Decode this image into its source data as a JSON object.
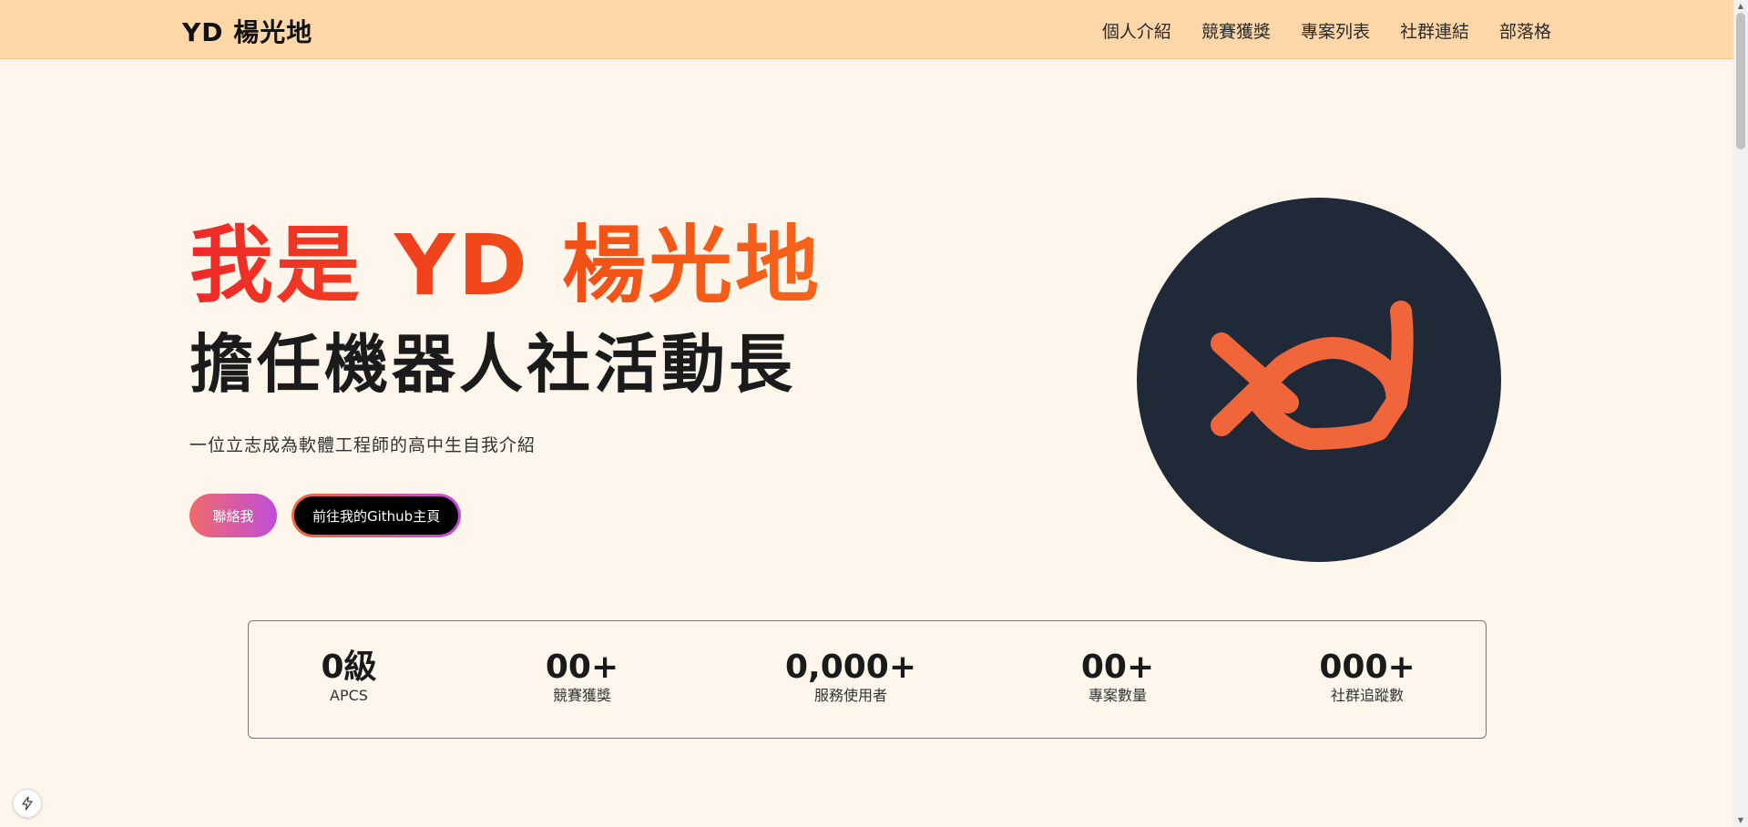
{
  "navbar": {
    "brand": "YD 楊光地",
    "links": [
      "個人介紹",
      "競賽獲獎",
      "專案列表",
      "社群連結",
      "部落格"
    ],
    "background_color": "#fed7a8"
  },
  "hero": {
    "title": "我是 YD 楊光地",
    "subtitle": "擔任機器人社活動長",
    "description": "一位立志成為軟體工程師的高中生自我介紹",
    "contact_button": "聯絡我",
    "github_button": "前往我的Github主頁",
    "logo_icon": "yd-logo-icon",
    "logo_bg_color": "#1f2937",
    "logo_stroke_color": "#f0663a"
  },
  "stats": [
    {
      "value": "0級",
      "label": "APCS"
    },
    {
      "value": "00+",
      "label": "競賽獲獎"
    },
    {
      "value": "0,000+",
      "label": "服務使用者"
    },
    {
      "value": "00+",
      "label": "專案數量"
    },
    {
      "value": "000+",
      "label": "社群追蹤數"
    }
  ],
  "colors": {
    "page_background": "#fef5eb",
    "title_gradient_start": "#ee2a2a",
    "title_gradient_end": "#f7641a"
  }
}
